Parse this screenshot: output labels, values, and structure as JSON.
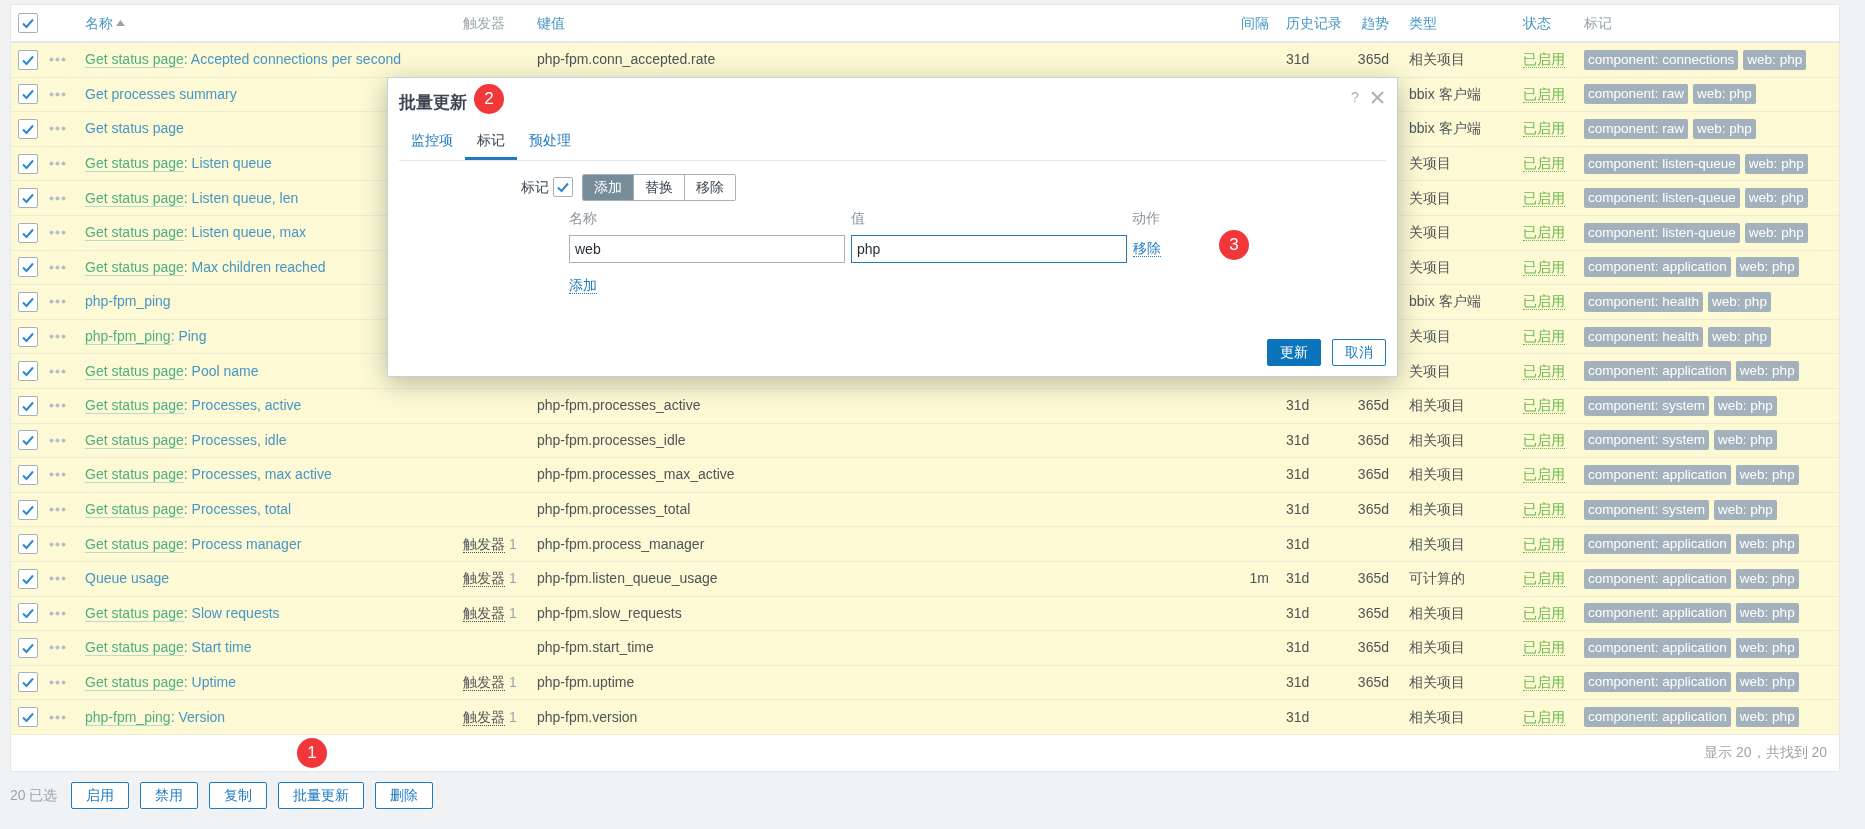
{
  "table": {
    "select_all": {
      "checked": true
    },
    "columns": [
      {
        "label": "名称",
        "sortable": true,
        "sorted_ascending": true
      },
      {
        "label": "触发器",
        "sortable": false,
        "sorted_ascending": false
      },
      {
        "label": "键值",
        "sortable": true,
        "sorted_ascending": false
      },
      {
        "label": "间隔",
        "sortable": true,
        "sorted_ascending": false
      },
      {
        "label": "历史记录",
        "sortable": true,
        "sorted_ascending": false
      },
      {
        "label": "趋势",
        "sortable": true,
        "sorted_ascending": false
      },
      {
        "label": "类型",
        "sortable": true,
        "sorted_ascending": false
      },
      {
        "label": "状态",
        "sortable": true,
        "sorted_ascending": false
      },
      {
        "label": "标记",
        "sortable": false,
        "sorted_ascending": false
      }
    ],
    "rows": [
      {
        "checked": true,
        "prefix": "Get status page",
        "name": ": Accepted connections per second",
        "key": "php-fpm.conn_accepted.rate",
        "history": "31d",
        "trend": "365d",
        "type": "相关项目",
        "status": "已启用",
        "tags": [
          "component: connections",
          "web: php"
        ]
      },
      {
        "checked": true,
        "name": "Get processes summary",
        "type": "bbix 客户端",
        "status": "已启用",
        "tags": [
          "component: raw",
          "web: php"
        ]
      },
      {
        "checked": true,
        "name": "Get status page",
        "type": "bbix 客户端",
        "status": "已启用",
        "tags": [
          "component: raw",
          "web: php"
        ]
      },
      {
        "checked": true,
        "prefix": "Get status page",
        "name": ": Listen queue",
        "type": "关项目",
        "status": "已启用",
        "tags": [
          "component: listen-queue",
          "web: php"
        ]
      },
      {
        "checked": true,
        "prefix": "Get status page",
        "name": ": Listen queue, len",
        "type": "关项目",
        "status": "已启用",
        "tags": [
          "component: listen-queue",
          "web: php"
        ]
      },
      {
        "checked": true,
        "prefix": "Get status page",
        "name": ": Listen queue, max",
        "type": "关项目",
        "status": "已启用",
        "tags": [
          "component: listen-queue",
          "web: php"
        ]
      },
      {
        "checked": true,
        "prefix": "Get status page",
        "name": ": Max children reached",
        "type": "关项目",
        "status": "已启用",
        "tags": [
          "component: application",
          "web: php"
        ]
      },
      {
        "checked": true,
        "name": "php-fpm_ping",
        "type": "bbix 客户端",
        "status": "已启用",
        "tags": [
          "component: health",
          "web: php"
        ]
      },
      {
        "checked": true,
        "prefix": "php-fpm_ping",
        "name": ": Ping",
        "type": "关项目",
        "status": "已启用",
        "tags": [
          "component: health",
          "web: php"
        ]
      },
      {
        "checked": true,
        "prefix": "Get status page",
        "name": ": Pool name",
        "type": "关项目",
        "status": "已启用",
        "tags": [
          "component: application",
          "web: php"
        ]
      },
      {
        "checked": true,
        "prefix": "Get status page",
        "name": ": Processes, active",
        "key": "php-fpm.processes_active",
        "history": "31d",
        "trend": "365d",
        "type": "相关项目",
        "status": "已启用",
        "tags": [
          "component: system",
          "web: php"
        ]
      },
      {
        "checked": true,
        "prefix": "Get status page",
        "name": ": Processes, idle",
        "key": "php-fpm.processes_idle",
        "history": "31d",
        "trend": "365d",
        "type": "相关项目",
        "status": "已启用",
        "tags": [
          "component: system",
          "web: php"
        ]
      },
      {
        "checked": true,
        "prefix": "Get status page",
        "name": ": Processes, max active",
        "key": "php-fpm.processes_max_active",
        "history": "31d",
        "trend": "365d",
        "type": "相关项目",
        "status": "已启用",
        "tags": [
          "component: application",
          "web: php"
        ]
      },
      {
        "checked": true,
        "prefix": "Get status page",
        "name": ": Processes, total",
        "key": "php-fpm.processes_total",
        "history": "31d",
        "trend": "365d",
        "type": "相关项目",
        "status": "已启用",
        "tags": [
          "component: system",
          "web: php"
        ]
      },
      {
        "checked": true,
        "prefix": "Get status page",
        "name": ": Process manager",
        "triggers": "触发器",
        "trigger_count": "1",
        "key": "php-fpm.process_manager",
        "history": "31d",
        "type": "相关项目",
        "status": "已启用",
        "tags": [
          "component: application",
          "web: php"
        ]
      },
      {
        "checked": true,
        "name": "Queue usage",
        "triggers": "触发器",
        "trigger_count": "1",
        "key": "php-fpm.listen_queue_usage",
        "interval": "1m",
        "history": "31d",
        "trend": "365d",
        "type": "可计算的",
        "status": "已启用",
        "tags": [
          "component: application",
          "web: php"
        ]
      },
      {
        "checked": true,
        "prefix": "Get status page",
        "name": ": Slow requests",
        "triggers": "触发器",
        "trigger_count": "1",
        "key": "php-fpm.slow_requests",
        "history": "31d",
        "trend": "365d",
        "type": "相关项目",
        "status": "已启用",
        "tags": [
          "component: application",
          "web: php"
        ]
      },
      {
        "checked": true,
        "prefix": "Get status page",
        "name": ": Start time",
        "key": "php-fpm.start_time",
        "history": "31d",
        "trend": "365d",
        "type": "相关项目",
        "status": "已启用",
        "tags": [
          "component: application",
          "web: php"
        ]
      },
      {
        "checked": true,
        "prefix": "Get status page",
        "name": ": Uptime",
        "triggers": "触发器",
        "trigger_count": "1",
        "key": "php-fpm.uptime",
        "history": "31d",
        "trend": "365d",
        "type": "相关项目",
        "status": "已启用",
        "tags": [
          "component: application",
          "web: php"
        ]
      },
      {
        "checked": true,
        "prefix": "php-fpm_ping",
        "name": ": Version",
        "triggers": "触发器",
        "trigger_count": "1",
        "key": "php-fpm.version",
        "history": "31d",
        "type": "相关项目",
        "status": "已启用",
        "tags": [
          "component: application",
          "web: php"
        ]
      }
    ],
    "footer": "显示 20，共找到 20"
  },
  "selection": {
    "count": "20 已选",
    "buttons": [
      "启用",
      "禁用",
      "复制",
      "批量更新",
      "删除"
    ]
  },
  "dialog": {
    "title": "批量更新",
    "help": "?",
    "tabs": [
      {
        "label": "监控项",
        "selected": false
      },
      {
        "label": "标记",
        "selected": true
      },
      {
        "label": "预处理",
        "selected": false
      }
    ],
    "tags_label": "标记",
    "tags_checked": true,
    "modes": [
      {
        "label": "添加",
        "selected": true
      },
      {
        "label": "替换",
        "selected": false
      },
      {
        "label": "移除",
        "selected": false
      }
    ],
    "headers": [
      "名称",
      "值",
      "动作"
    ],
    "tag_rows": [
      {
        "name": "web",
        "value": "php",
        "action": "移除"
      }
    ],
    "add_link": "添加",
    "buttons": [
      {
        "label": "更新",
        "kind": "primary"
      },
      {
        "label": "取消",
        "kind": "secondary"
      }
    ]
  },
  "annotations": [
    "1",
    "2",
    "3"
  ]
}
